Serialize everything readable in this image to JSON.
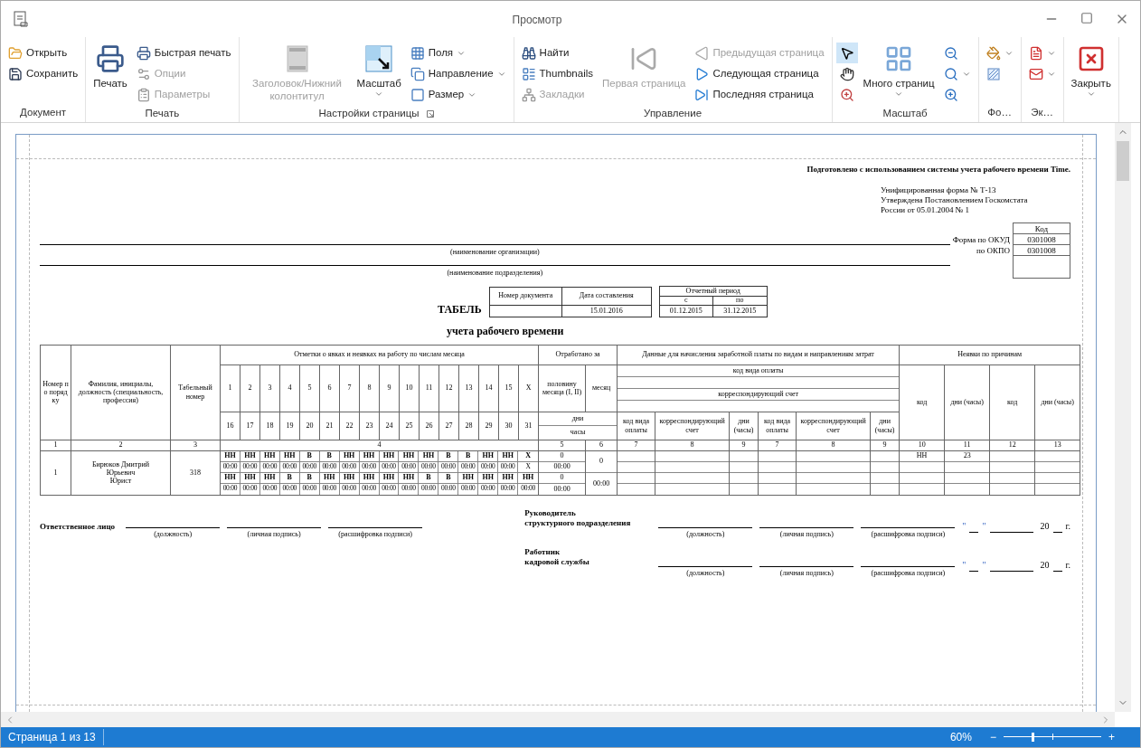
{
  "window": {
    "title": "Просмотр"
  },
  "ribbon": {
    "groups": [
      {
        "label": "Документ",
        "items": [
          {
            "kind": "small",
            "label": "Открыть",
            "disabled": false
          },
          {
            "kind": "small",
            "label": "Сохранить",
            "disabled": false
          }
        ]
      },
      {
        "label": "Печать",
        "items": [
          {
            "kind": "large",
            "label": "Печать",
            "disabled": false
          },
          {
            "kind": "small",
            "label": "Быстрая печать",
            "disabled": false
          },
          {
            "kind": "small",
            "label": "Опции",
            "disabled": true
          },
          {
            "kind": "small",
            "label": "Параметры",
            "disabled": true
          }
        ]
      },
      {
        "label": "Настройки страницы",
        "launcher": true,
        "items": [
          {
            "kind": "large",
            "label": "Заголовок/Нижний колонтитул",
            "disabled": true
          },
          {
            "kind": "large",
            "label": "Масштаб",
            "disabled": false,
            "dropdown": true
          },
          {
            "kind": "small",
            "label": "Поля",
            "disabled": false,
            "dropdown": true
          },
          {
            "kind": "small",
            "label": "Направление",
            "disabled": false,
            "dropdown": true
          },
          {
            "kind": "small",
            "label": "Размер",
            "disabled": false,
            "dropdown": true
          }
        ]
      },
      {
        "label": "Управление",
        "items": [
          {
            "kind": "small",
            "label": "Найти",
            "disabled": false
          },
          {
            "kind": "small",
            "label": "Thumbnails",
            "disabled": false
          },
          {
            "kind": "small",
            "label": "Закладки",
            "disabled": true
          },
          {
            "kind": "large",
            "label": "Первая страница",
            "disabled": true
          },
          {
            "kind": "small",
            "label": "Предыдущая страница",
            "disabled": true
          },
          {
            "kind": "small",
            "label": "Следующая страница",
            "disabled": false
          },
          {
            "kind": "small",
            "label": "Последняя страница",
            "disabled": false
          }
        ]
      },
      {
        "label": "Масштаб",
        "items": [
          {
            "kind": "icon",
            "selected": true
          },
          {
            "kind": "icon",
            "selected": false
          },
          {
            "kind": "icon",
            "selected": false
          },
          {
            "kind": "large",
            "label": "Много страниц",
            "disabled": false,
            "dropdown": true
          },
          {
            "kind": "icon"
          },
          {
            "kind": "icon",
            "dropdown": true
          },
          {
            "kind": "icon"
          }
        ]
      },
      {
        "label": "Фо…",
        "items": [
          {
            "kind": "icon",
            "dropdown": true
          },
          {
            "kind": "icon"
          }
        ]
      },
      {
        "label": "Эк…",
        "items": [
          {
            "kind": "icon",
            "dropdown": true
          },
          {
            "kind": "icon",
            "dropdown": true
          }
        ]
      },
      {
        "items": [
          {
            "kind": "large",
            "label": "Закрыть",
            "disabled": false,
            "dropdown": true
          }
        ]
      }
    ]
  },
  "timesheet": {
    "prepared_note": "Подготовлено с использованием системы учета рабочего времени Time.",
    "form_info": [
      "Унифицированная форма № Т-13",
      "Утверждена Постановлением Госкомстата",
      "России от 05.01.2004 № 1"
    ],
    "code_box": {
      "header": "Код",
      "rows": [
        {
          "label": "Форма по ОКУД",
          "value": "0301008"
        },
        {
          "label": "по ОКПО",
          "value": "0301008"
        }
      ]
    },
    "org_caption": "(наименование организации)",
    "dept_caption": "(наименование подразделения)",
    "doc_box": {
      "number_label": "Номер документа",
      "date_label": "Дата составления",
      "date": "15.01.2016"
    },
    "period_box": {
      "title": "Отчетный период",
      "from_label": "с",
      "to_label": "по",
      "from": "01.12.2015",
      "to": "31.12.2015"
    },
    "title": "ТАБЕЛЬ",
    "subtitle": "учета рабочего времени",
    "table": {
      "head": {
        "number": "Номер по порядку",
        "name": "Фамилия, инициалы, должность (специальность, профессия)",
        "tab_number": "Табельный номер",
        "marks_title": "Отметки о явках и неявках на работу по числам месяца",
        "days_first": [
          "1",
          "2",
          "3",
          "4",
          "5",
          "6",
          "7",
          "8",
          "9",
          "10",
          "11",
          "12",
          "13",
          "14",
          "15",
          "X"
        ],
        "days_second": [
          "16",
          "17",
          "18",
          "19",
          "20",
          "21",
          "22",
          "23",
          "24",
          "25",
          "26",
          "27",
          "28",
          "29",
          "30",
          "31"
        ],
        "worked_title": "Отработано за",
        "half_month": "половину месяца (I, II)",
        "month": "месяц",
        "days_label": "дни",
        "hours_label": "часы",
        "pay_title": "Данные для начисления заработной платы по видам и направлениям затрат",
        "pay_code": "код вида оплаты",
        "pay_account": "корреспондирующий счет",
        "pay_subcols": [
          "код вида оплаты",
          "корреспондирующий счет",
          "дни (часы)",
          "код вида оплаты",
          "корреспондирующий счет",
          "дни (часы)"
        ],
        "absence_title": "Неявки по причинам",
        "absence_cols": [
          "код",
          "дни (часы)",
          "код",
          "дни (часы)"
        ]
      },
      "numbers": [
        "1",
        "2",
        "3",
        "4",
        "5",
        "6",
        "7",
        "8",
        "9",
        "7",
        "8",
        "9",
        "10",
        "11",
        "12",
        "13"
      ],
      "rows": [
        {
          "num": "1",
          "name_lines": [
            "Бирюков Дмитрий",
            "Юрьевич",
            "Юрист"
          ],
          "tab_number": "318",
          "marks_first": [
            "НН",
            "НН",
            "НН",
            "НН",
            "В",
            "В",
            "НН",
            "НН",
            "НН",
            "НН",
            "НН",
            "В",
            "В",
            "НН",
            "НН",
            "X"
          ],
          "hours_first": [
            "00:00",
            "00:00",
            "00:00",
            "00:00",
            "00:00",
            "00:00",
            "00:00",
            "00:00",
            "00:00",
            "00:00",
            "00:00",
            "00:00",
            "00:00",
            "00:00",
            "00:00",
            "X"
          ],
          "marks_second": [
            "НН",
            "НН",
            "НН",
            "В",
            "В",
            "НН",
            "НН",
            "НН",
            "НН",
            "НН",
            "В",
            "В",
            "НН",
            "НН",
            "НН",
            "НН"
          ],
          "hours_second": [
            "00:00",
            "00:00",
            "00:00",
            "00:00",
            "00:00",
            "00:00",
            "00:00",
            "00:00",
            "00:00",
            "00:00",
            "00:00",
            "00:00",
            "00:00",
            "00:00",
            "00:00",
            "00:00"
          ],
          "half_values": [
            "0",
            "00:00",
            "0",
            "00:00"
          ],
          "month_values": [
            "0",
            "00:00"
          ],
          "absence": [
            {
              "code": "НН",
              "days": "23"
            }
          ]
        }
      ]
    },
    "signatures": {
      "left": {
        "label": "Ответственное лицо",
        "captions": [
          "(должность)",
          "(личная подпись)",
          "(расшифровка подписи)"
        ]
      },
      "right": [
        {
          "label_lines": [
            "Руководитель",
            "структурного подразделения"
          ],
          "captions": [
            "(должность)",
            "(личная подпись)",
            "(расшифровка подписи)"
          ],
          "date": {
            "quote_open": "\"",
            "quote_close": "\"",
            "century": "20",
            "year_suffix": "г."
          }
        },
        {
          "label_lines": [
            "Работник",
            "кадровой службы"
          ],
          "captions": [
            "(должность)",
            "(личная подпись)",
            "(расшифровка подписи)"
          ],
          "date": {
            "quote_open": "\"",
            "quote_close": "\"",
            "century": "20",
            "year_suffix": "г."
          }
        }
      ]
    }
  },
  "status_bar": {
    "page": "Страница 1 из 13",
    "zoom": "60%",
    "zoom_out": "−",
    "zoom_in": "+",
    "level": 0.3
  }
}
